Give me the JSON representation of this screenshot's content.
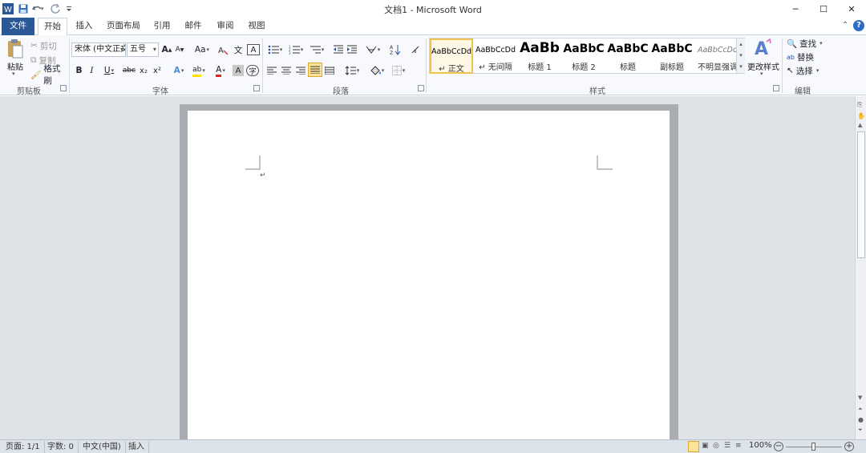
{
  "title": "文档1 - Microsoft Word",
  "quick_access": {
    "app_icon": "word-icon",
    "save": "save-icon",
    "undo": "undo-icon",
    "redo": "redo-icon",
    "customize": "customize-qat-icon"
  },
  "window": {
    "minimize": "─",
    "maximize": "☐",
    "close": "✕"
  },
  "tabs": [
    "文件",
    "开始",
    "插入",
    "页面布局",
    "引用",
    "邮件",
    "审阅",
    "视图"
  ],
  "active_tab": "开始",
  "help": {
    "collapse": "⌃",
    "help": "?"
  },
  "clipboard": {
    "label": "剪贴板",
    "paste": "粘贴",
    "cut": "剪切",
    "copy": "复制",
    "format_painter": "格式刷"
  },
  "font": {
    "label": "字体",
    "font_name": "宋体 (中文正文)",
    "font_size": "五号",
    "grow": "A",
    "shrink": "A",
    "case": "Aa",
    "phonetic": "文",
    "char_border": "A",
    "bold": "B",
    "italic": "I",
    "underline": "U",
    "strike": "abc",
    "sub": "x₂",
    "sup": "x²",
    "text_effect": "A",
    "highlight": "ab",
    "font_color": "A",
    "char_shade": "A",
    "enclose": "字"
  },
  "paragraph": {
    "label": "段落"
  },
  "styles": {
    "label": "样式",
    "change_styles": "更改样式",
    "items": [
      {
        "preview": "AaBbCcDd",
        "name": "↵ 正文",
        "selected": true
      },
      {
        "preview": "AaBbCcDd",
        "name": "↵ 无间隔",
        "selected": false
      },
      {
        "preview": "AaBb",
        "name": "标题 1",
        "selected": false
      },
      {
        "preview": "AaBbC",
        "name": "标题 2",
        "selected": false
      },
      {
        "preview": "AaBbC",
        "name": "标题",
        "selected": false
      },
      {
        "preview": "AaBbC",
        "name": "副标题",
        "selected": false
      },
      {
        "preview": "AaBbCcDd",
        "name": "不明显强调",
        "selected": false
      }
    ]
  },
  "editing": {
    "label": "编辑",
    "find": "查找",
    "replace": "替换",
    "select": "选择"
  },
  "status": {
    "page": "页面: 1/1",
    "words": "字数: 0",
    "language": "中文(中国)",
    "mode": "插入",
    "zoom": "100%"
  },
  "colors": {
    "accent": "#2b5797",
    "ribbon_bg": "#f7f9fc",
    "workspace": "#dfe3e8",
    "highlight": "#ffe000",
    "font_red": "#e02020"
  }
}
